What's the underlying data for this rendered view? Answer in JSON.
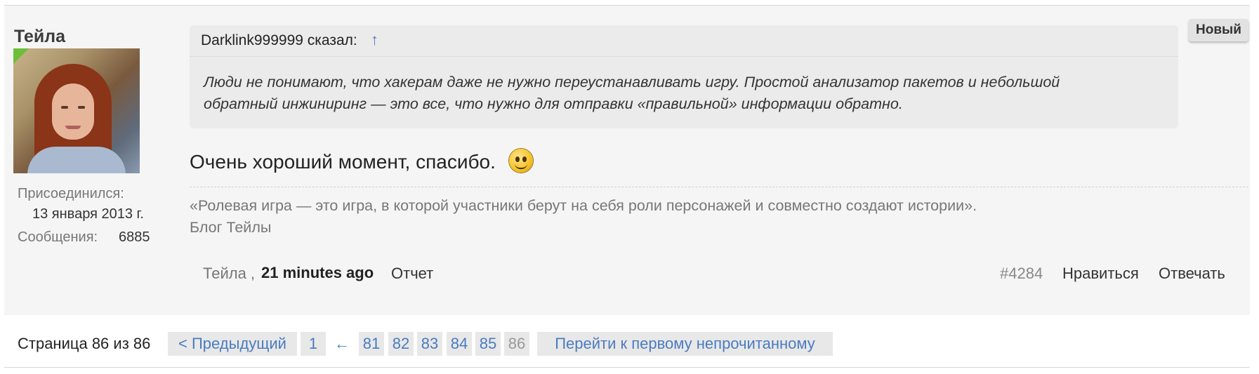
{
  "post": {
    "author": "Тейла",
    "joined_label": "Присоединился:",
    "joined_date": "13 января 2013 г.",
    "messages_label": "Сообщения:",
    "messages_count": "6885",
    "badge": "Новый",
    "quote": {
      "author": "Darklink999999 сказал:",
      "arrow": "↑",
      "line1": "Люди не понимают, что хакерам даже не нужно переустанавливать игру. Простой анализатор пакетов и небольшой",
      "line2": "обратный инжиниринг — это все, что нужно для отправки «правильной» информации обратно."
    },
    "message": "Очень хороший момент, спасибо.",
    "signature": {
      "line1": "«Ролевая игра — это игра, в которой участники берут на себя роли персонажей и совместно создают истории».",
      "line2": "Блог Тейлы"
    },
    "footer": {
      "author": "Тейла ,",
      "time": "21 minutes ago",
      "report": "Отчет",
      "post_number": "#4284",
      "like": "Нравиться",
      "reply": "Отвечать"
    }
  },
  "pagination": {
    "label": "Страница 86 из 86",
    "prev": "< Предыдущий",
    "first": "1",
    "jump_icon": "←",
    "pages": [
      "81",
      "82",
      "83",
      "84",
      "85"
    ],
    "current": "86",
    "unread": "Перейти к первому непрочитанному"
  }
}
